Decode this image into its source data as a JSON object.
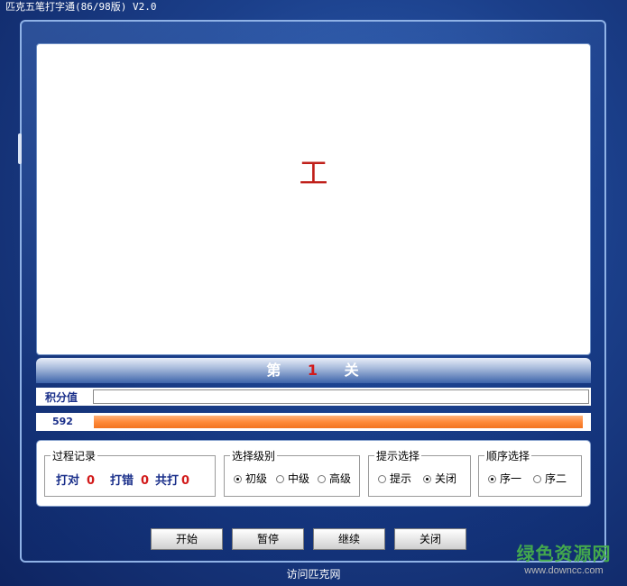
{
  "window": {
    "title": "匹克五笔打字通(86/98版) V2.0"
  },
  "display": {
    "target_char": "工"
  },
  "level": {
    "prefix": "第",
    "number": "1",
    "suffix": "关"
  },
  "score": {
    "label": "积分值",
    "value": ""
  },
  "progress": {
    "value_label": "592",
    "fill_percent": 100
  },
  "record": {
    "title": "过程记录",
    "correct_label": "打对",
    "correct_value": "0",
    "wrong_label": "打错",
    "wrong_value": "0",
    "total_label": "共打",
    "total_value": "0"
  },
  "difficulty": {
    "title": "选择级别",
    "options": [
      "初级",
      "中级",
      "高级"
    ],
    "selected": "初级"
  },
  "hint": {
    "title": "提示选择",
    "options": [
      "提示",
      "关闭"
    ],
    "selected": "关闭"
  },
  "order": {
    "title": "顺序选择",
    "options": [
      "序一",
      "序二"
    ],
    "selected": "序一"
  },
  "buttons": {
    "start": "开始",
    "pause": "暂停",
    "resume": "继续",
    "close": "关闭"
  },
  "footer": {
    "link": "访问匹克网"
  },
  "watermark": {
    "main": "绿色资源网",
    "sub": "www.downcc.com"
  },
  "colors": {
    "accent_red": "#d21a1a",
    "label_blue": "#1a2f8a",
    "progress_orange": "#ff8a3a"
  }
}
